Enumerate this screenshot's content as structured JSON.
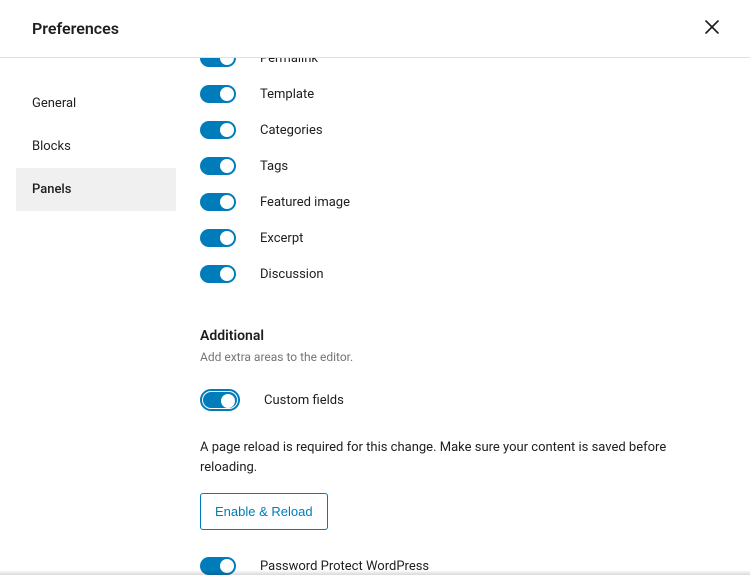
{
  "header": {
    "title": "Preferences"
  },
  "sidebar": {
    "items": [
      {
        "label": "General"
      },
      {
        "label": "Blocks"
      },
      {
        "label": "Panels"
      }
    ]
  },
  "panels": {
    "toggles": [
      {
        "label": "Permalink"
      },
      {
        "label": "Template"
      },
      {
        "label": "Categories"
      },
      {
        "label": "Tags"
      },
      {
        "label": "Featured image"
      },
      {
        "label": "Excerpt"
      },
      {
        "label": "Discussion"
      }
    ]
  },
  "additional": {
    "title": "Additional",
    "description": "Add extra areas to the editor.",
    "custom_fields_label": "Custom fields",
    "reload_note": "A page reload is required for this change. Make sure your content is saved before reloading.",
    "reload_button": "Enable & Reload",
    "ppwp_label": "Password Protect WordPress"
  }
}
